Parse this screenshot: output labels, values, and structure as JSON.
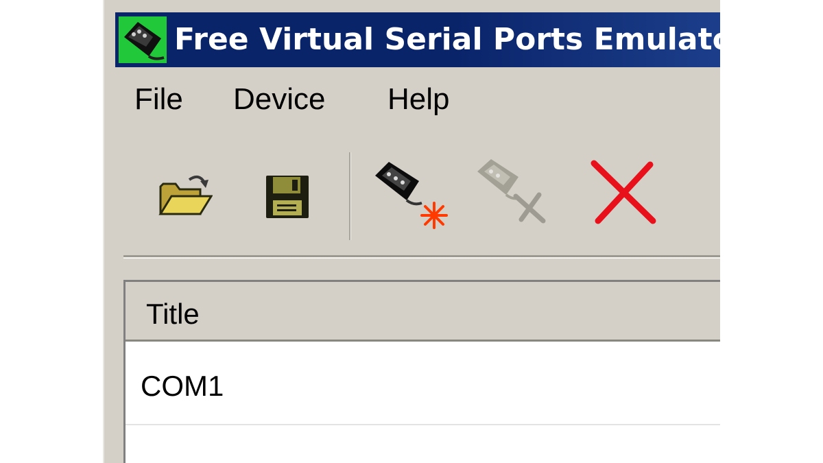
{
  "window": {
    "title": "Free Virtual Serial Ports Emulator"
  },
  "menu": {
    "items": [
      {
        "label": "File"
      },
      {
        "label": "Device"
      },
      {
        "label": "Help"
      }
    ]
  },
  "toolbar": {
    "buttons": [
      {
        "icon": "open-folder-icon"
      },
      {
        "icon": "save-floppy-icon"
      },
      {
        "icon": "new-device-icon"
      },
      {
        "icon": "edit-device-icon"
      },
      {
        "icon": "delete-x-icon"
      }
    ]
  },
  "colors": {
    "titlebar": "#0a246a",
    "window_face": "#d4d0c8",
    "title_icon_bg": "#21c83a",
    "delete_red": "#e8101a",
    "spark_orange": "#ff3a00"
  },
  "list": {
    "columns": [
      {
        "label": "Title"
      }
    ],
    "rows": [
      {
        "title": "COM1"
      }
    ]
  }
}
